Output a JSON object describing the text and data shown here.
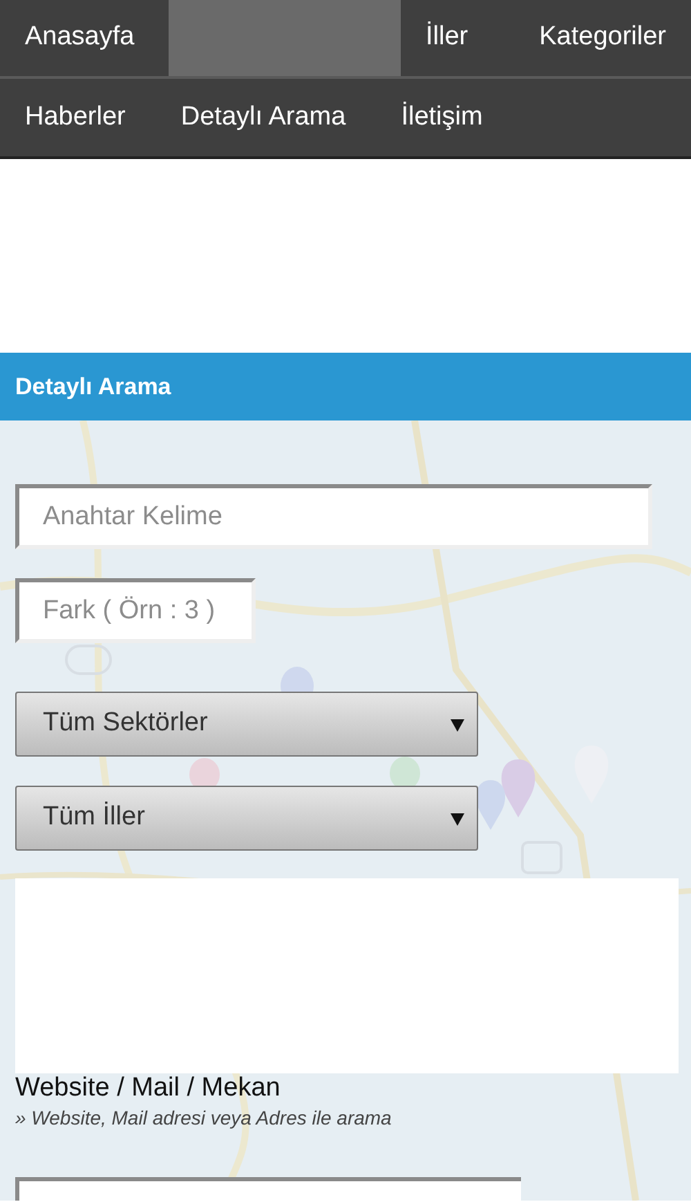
{
  "nav_rows": [
    {
      "items": [
        {
          "kind": "link",
          "label": "Anasayfa",
          "selected": false
        },
        {
          "kind": "blank",
          "selected": true
        },
        {
          "kind": "link",
          "label": "İller",
          "selected": false
        },
        {
          "kind": "link",
          "label": "Kategoriler",
          "selected": false
        }
      ]
    },
    {
      "items": [
        {
          "kind": "link",
          "label": "Haberler",
          "selected": false
        },
        {
          "kind": "link",
          "label": "Detaylı Arama",
          "selected": false
        },
        {
          "kind": "link",
          "label": "İletişim",
          "selected": false
        }
      ]
    }
  ],
  "section_header": {
    "title": "Detaylı Arama"
  },
  "form": {
    "fields": [
      {
        "kind": "text",
        "placeholder": "Anahtar Kelime"
      },
      {
        "kind": "short_text",
        "placeholder": "Fark ( Örn : 3 )"
      },
      {
        "kind": "select",
        "value": "Tüm Sektörler"
      },
      {
        "kind": "select",
        "value": "Tüm İller"
      },
      {
        "kind": "panel"
      },
      {
        "kind": "label",
        "title": "Website / Mail / Mekan",
        "hint": "» Website, Mail adresi veya Adres ile arama"
      },
      {
        "kind": "text_partial"
      }
    ]
  }
}
